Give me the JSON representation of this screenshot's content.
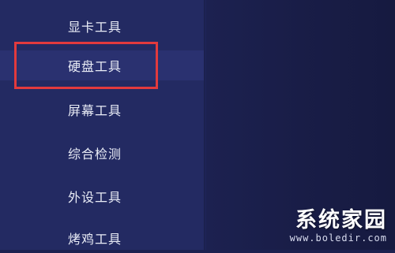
{
  "sidebar": {
    "items": [
      {
        "label": "显卡工具"
      },
      {
        "label": "硬盘工具"
      },
      {
        "label": "屏幕工具"
      },
      {
        "label": "综合检测"
      },
      {
        "label": "外设工具"
      },
      {
        "label": "烤鸡工具"
      }
    ],
    "selected_index": 1
  },
  "watermark": {
    "title": "系统家园",
    "url": "www.boledir.com"
  },
  "colors": {
    "sidebar_bg": "#232a62",
    "content_bg": "#191d47",
    "selected_bg": "#2a3170",
    "highlight_border": "#e23a3d",
    "label_text": "#e9ecf6"
  }
}
